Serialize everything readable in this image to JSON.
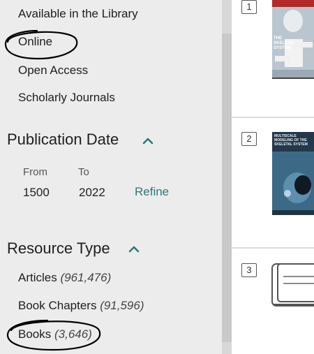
{
  "access_filters": [
    {
      "label": "Available in the Library"
    },
    {
      "label": "Online"
    },
    {
      "label": "Open Access"
    },
    {
      "label": "Scholarly Journals"
    }
  ],
  "publication_date": {
    "title": "Publication Date",
    "from_label": "From",
    "to_label": "To",
    "from_value": "1500",
    "to_value": "2022",
    "refine_label": "Refine"
  },
  "resource_type": {
    "title": "Resource Type",
    "items": [
      {
        "label": "Articles",
        "count": "(961,476)"
      },
      {
        "label": "Book Chapters",
        "count": "(91,596)"
      },
      {
        "label": "Books",
        "count": "(3,646)"
      }
    ]
  },
  "results": [
    {
      "number": "1",
      "cover_text": [
        "THE",
        "SKELETAL",
        "SYSTEM"
      ]
    },
    {
      "number": "2",
      "cover_text": [
        "MULTISCALE",
        "MODELING OF THE",
        "SKELETAL SYSTEM"
      ]
    },
    {
      "number": "3",
      "cover_text": []
    }
  ],
  "colors": {
    "sidebar_bg": "#ececec",
    "link_accent": "#2a7a78",
    "annotation_ink": "#000000"
  },
  "icons": {
    "section_toggle": "chevron-up-icon",
    "generic_book": "book-icon"
  }
}
